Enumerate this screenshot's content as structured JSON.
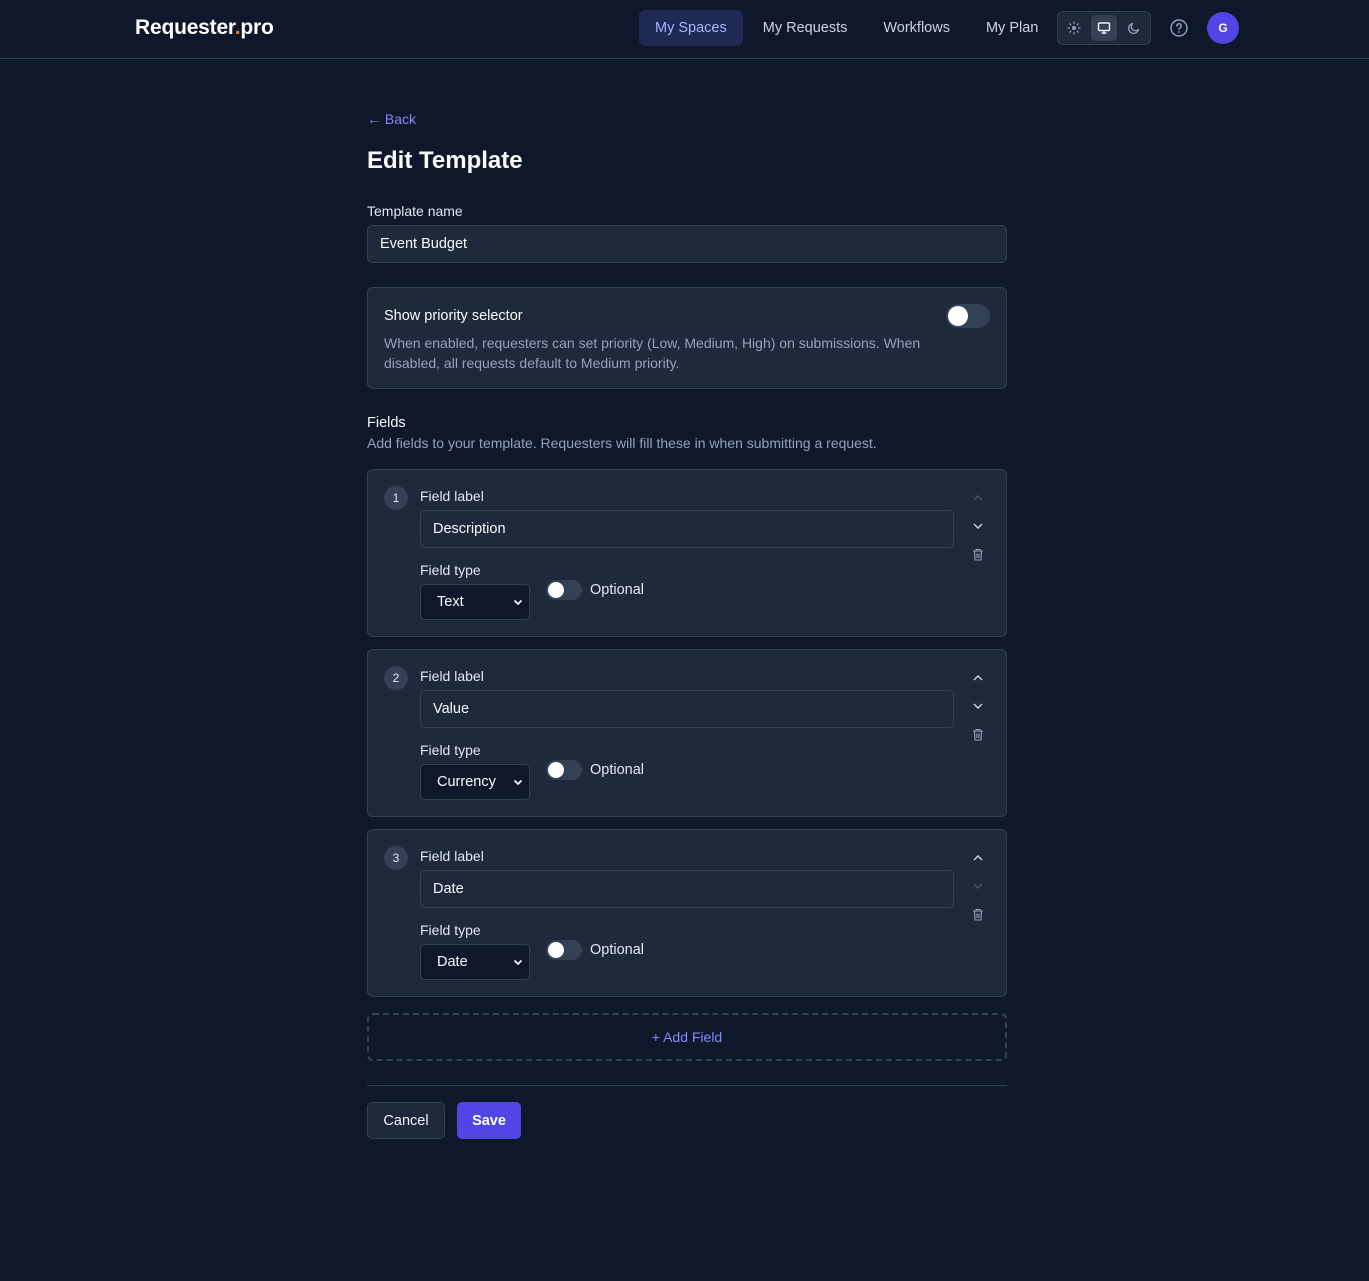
{
  "header": {
    "logo_main": "Requester",
    "logo_dot": ".",
    "logo_tld": "pro",
    "nav": [
      {
        "label": "My Spaces",
        "active": true
      },
      {
        "label": "My Requests",
        "active": false
      },
      {
        "label": "Workflows",
        "active": false
      },
      {
        "label": "My Plan",
        "active": false
      }
    ],
    "theme_options": [
      "light-icon",
      "monitor-icon",
      "moon-icon"
    ],
    "theme_selected": "monitor-icon",
    "avatar_initial": "G"
  },
  "page": {
    "back_label": "← Back",
    "title": "Edit Template",
    "template_name_label": "Template name",
    "template_name_value": "Event Budget",
    "priority": {
      "title": "Show priority selector",
      "description": "When enabled, requesters can set priority (Low, Medium, High) on submissions. When disabled, all requests default to Medium priority.",
      "enabled": false
    },
    "fields_title": "Fields",
    "fields_description": "Add fields to your template. Requesters will fill these in when submitting a request.",
    "field_label_caption": "Field label",
    "field_type_caption": "Field type",
    "optional_caption": "Optional",
    "fields": [
      {
        "number": "1",
        "label": "Description",
        "type": "Text",
        "optional": false
      },
      {
        "number": "2",
        "label": "Value",
        "type": "Currency",
        "optional": false
      },
      {
        "number": "3",
        "label": "Date",
        "type": "Date",
        "optional": false
      }
    ],
    "add_field_label": "+ Add Field",
    "cancel_label": "Cancel",
    "save_label": "Save"
  },
  "colors": {
    "background": "#0f172a",
    "card": "#1e293b",
    "border": "#334155",
    "accent": "#4f46e5",
    "link": "#818cf8",
    "logo_dot": "#f97316"
  }
}
